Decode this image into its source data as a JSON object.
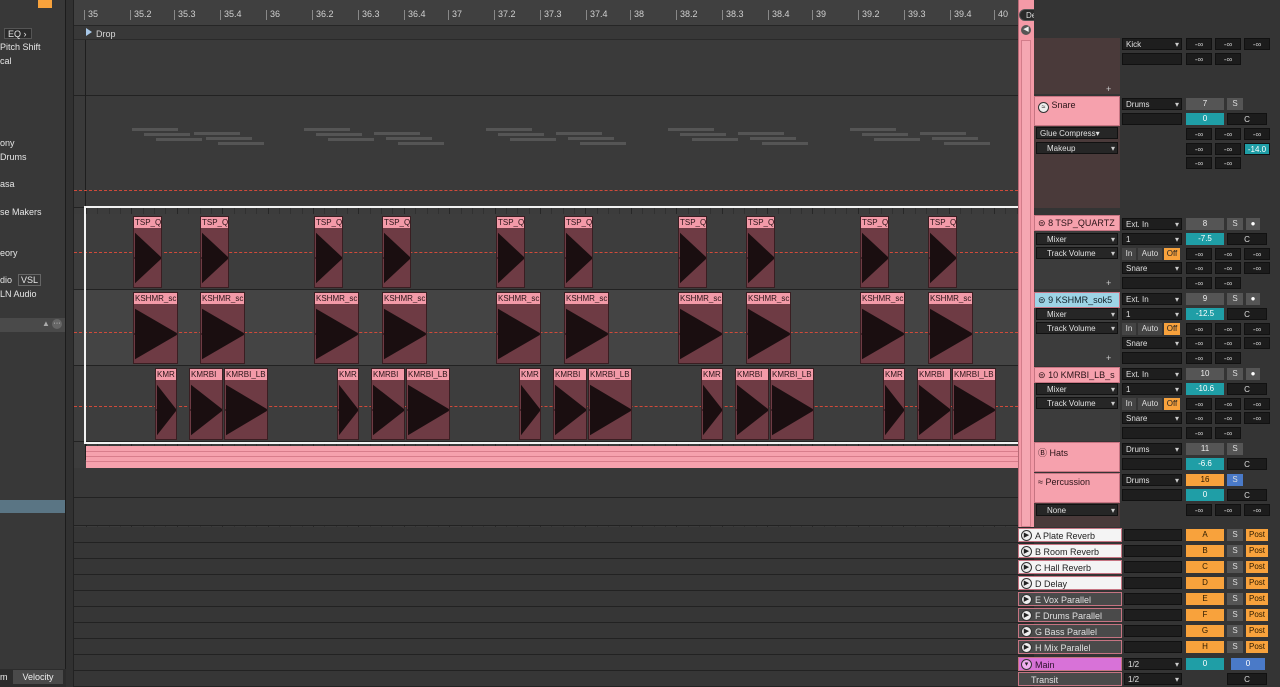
{
  "left_panel": {
    "items": [
      "EQ",
      "Pitch Shift",
      "cal",
      "ony",
      "Drums",
      "asa",
      "se Makers",
      "eory",
      "dio",
      "VSL",
      "LN Audio"
    ],
    "bottom_tabs": [
      "m",
      "Velocity"
    ]
  },
  "ruler": {
    "ticks": [
      "35",
      "35.2",
      "35.3",
      "35.4",
      "36",
      "36.2",
      "36.3",
      "36.4",
      "37",
      "37.2",
      "37.3",
      "37.4",
      "38",
      "38.2",
      "38.3",
      "38.4",
      "39",
      "39.2",
      "39.3",
      "39.4",
      "40"
    ]
  },
  "locator": {
    "label": "Drop"
  },
  "clips": {
    "tsp_label": "TSP_Q",
    "kshmr_label": "KSHMR_sc",
    "kmr_short": "KMR",
    "kmrbi_label": "KMRBI",
    "kmrbi_lb_label": "KMRBI_LB"
  },
  "toolbar": {
    "del": "Del"
  },
  "mixer": {
    "kick": {
      "route": "Kick",
      "neg_inf": "-∞"
    },
    "snare": {
      "title": "Snare",
      "route": "Drums",
      "num": "7",
      "s": "S",
      "vol": "0",
      "c": "C",
      "device": "Glue Compress",
      "param": "Makeup",
      "value": "-14.0"
    },
    "tsp": {
      "title": "8 TSP_QUARTZ",
      "input": "Ext. In",
      "mix": "Mixer",
      "ch": "1",
      "param": "Track Volume",
      "out": "Snare",
      "num": "8",
      "vol": "-7.5",
      "in_label": "In",
      "auto_label": "Auto",
      "off_label": "Off"
    },
    "kshmr": {
      "title": "9 KSHMR_sok5",
      "input": "Ext. In",
      "mix": "Mixer",
      "ch": "1",
      "param": "Track Volume",
      "out": "Snare",
      "num": "9",
      "vol": "-12.5"
    },
    "kmrbi": {
      "title": "10 KMRBI_LB_s",
      "input": "Ext. In",
      "mix": "Mixer",
      "ch": "1",
      "param": "Track Volume",
      "out": "Snare",
      "num": "10",
      "vol": "-10.6"
    },
    "hats": {
      "title": "Hats",
      "route": "Drums",
      "num": "11",
      "vol": "-6.6"
    },
    "perc": {
      "title": "Percussion",
      "route": "Drums",
      "num": "16",
      "vol": "0",
      "device": "None"
    },
    "returns": [
      {
        "name": "A Plate Reverb",
        "letter": "A"
      },
      {
        "name": "B Room Reverb",
        "letter": "B"
      },
      {
        "name": "C Hall Reverb",
        "letter": "C"
      },
      {
        "name": "D Delay",
        "letter": "D"
      },
      {
        "name": "E Vox Parallel",
        "letter": "E"
      },
      {
        "name": "F Drums Parallel",
        "letter": "F"
      },
      {
        "name": "G Bass Parallel",
        "letter": "G"
      },
      {
        "name": "H Mix Parallel",
        "letter": "H"
      }
    ],
    "post": "Post",
    "main": {
      "title": "Main",
      "route": "1/2",
      "vol": "0",
      "pan": "0"
    },
    "transit": {
      "title": "Transit",
      "route": "1/2",
      "c": "C"
    }
  },
  "colors": {
    "clip_head": "#f39aa8",
    "clip_body": "#6e3b44",
    "selected_track": "#9ed4e6",
    "accent_orange": "#f8a23c",
    "teal": "#1f9ea6",
    "main": "#d872d8"
  }
}
